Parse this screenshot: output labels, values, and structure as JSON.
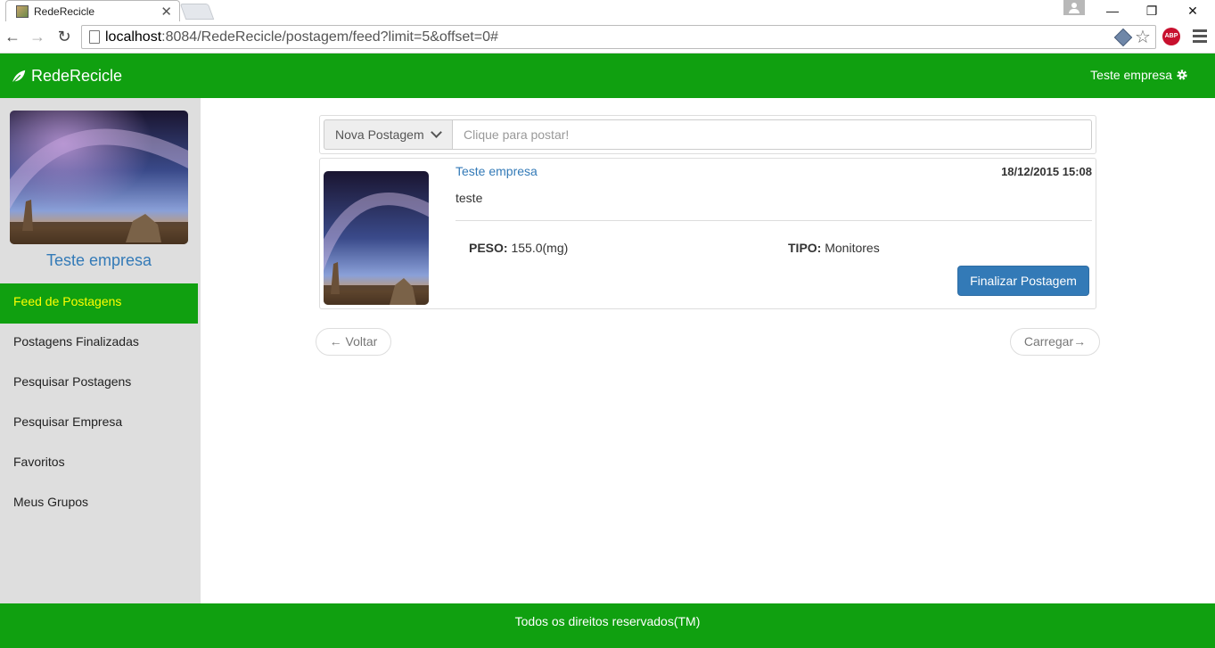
{
  "browser": {
    "tab_title": "RedeRecicle",
    "url_host": "localhost",
    "url_rest": ":8084/RedeRecicle/postagem/feed?limit=5&offset=0#",
    "abp_label": "ABP"
  },
  "navbar": {
    "brand": "RedeRecicle",
    "user": "Teste empresa"
  },
  "sidebar": {
    "profile_name": "Teste empresa",
    "items": [
      {
        "label": "Feed de Postagens",
        "active": true
      },
      {
        "label": "Postagens Finalizadas"
      },
      {
        "label": "Pesquisar Postagens"
      },
      {
        "label": "Pesquisar Empresa"
      },
      {
        "label": "Favoritos"
      },
      {
        "label": "Meus Grupos"
      }
    ]
  },
  "composer": {
    "dropdown_label": "Nova Postagem",
    "placeholder": "Clique para postar!"
  },
  "post": {
    "author": "Teste empresa",
    "date": "18/12/2015 15:08",
    "text": "teste",
    "peso_label": "PESO:",
    "peso_value": "155.0(mg)",
    "tipo_label": "TIPO:",
    "tipo_value": "Monitores",
    "finalize_label": "Finalizar Postagem"
  },
  "pager": {
    "prev": "← Voltar",
    "next": "Carregar→"
  },
  "footer": {
    "text": "Todos os direitos reservados(TM)"
  },
  "colors": {
    "brand_green": "#10a010",
    "active_text": "#ffff00",
    "link_blue": "#337ab7",
    "sidebar_bg": "#dedede"
  }
}
